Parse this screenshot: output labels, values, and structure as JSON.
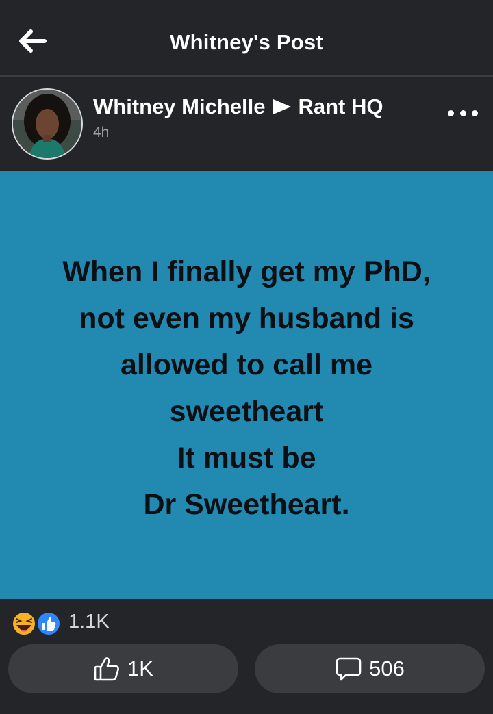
{
  "header": {
    "title": "Whitney's Post",
    "back_icon": "arrow-left-icon"
  },
  "post": {
    "author": "Whitney Michelle",
    "group": "Rant HQ",
    "time": "4h",
    "text": "When I finally get my PhD,\nnot even my husband is\nallowed to call me\nsweetheart\nIt must be\nDr Sweetheart.",
    "background_color": "#228ab0"
  },
  "reactions": {
    "icons": [
      "laughing-emoji-icon",
      "like-badge-icon"
    ],
    "count": "1.1K"
  },
  "actions": {
    "like_count": "1K",
    "comment_count": "506"
  },
  "colors": {
    "bar": "#232528",
    "button": "#3a3c40",
    "like_blue": "#2d88ff",
    "haha_yellow": "#f7b125"
  }
}
